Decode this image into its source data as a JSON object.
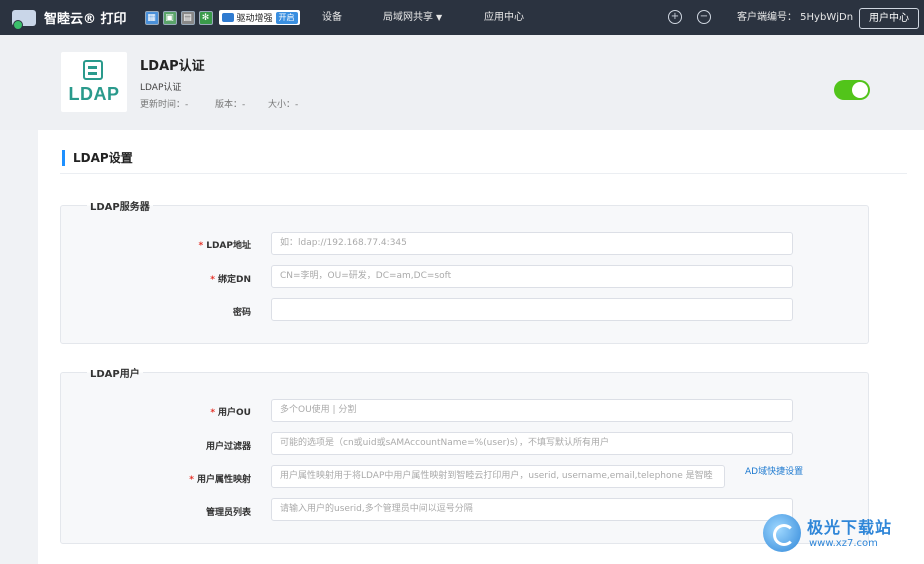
{
  "topbar": {
    "brand": "智睦云® 打印",
    "driver_label": "驱动增强",
    "driver_badge": "开启",
    "nav": [
      "设备",
      "局域网共享",
      "应用中心"
    ],
    "client_id": "客户端编号： 5HybWjDn",
    "user_center": "用户中心"
  },
  "app": {
    "logo_text": "LDAP",
    "title": "LDAP认证",
    "subtitle": "LDAP认证",
    "updated": "更新时间：-",
    "version": "版本：-",
    "size": "大小：-",
    "enabled": true
  },
  "main": {
    "section_title": "LDAP设置",
    "server": {
      "legend": "LDAP服务器",
      "fields": [
        {
          "label": "LDAP地址",
          "required": true,
          "placeholder": "如：ldap://192.168.77.4:345"
        },
        {
          "label": "绑定DN",
          "required": true,
          "placeholder": "CN=李明，OU=研发，DC=am,DC=soft"
        },
        {
          "label": "密码",
          "required": false,
          "placeholder": ""
        }
      ]
    },
    "user": {
      "legend": "LDAP用户",
      "fields": [
        {
          "label": "用户OU",
          "required": true,
          "placeholder": "多个OU使用 | 分割"
        },
        {
          "label": "用户过滤器",
          "required": false,
          "placeholder": "可能的选项是（cn或uid或sAMAccountName=%(user)s），不填写默认所有用户"
        },
        {
          "label": "用户属性映射",
          "required": true,
          "placeholder": "用户属性映射用于将LDAP中用户属性映射到智睦云打印用户，userid, username,email,telephone 是智睦"
        },
        {
          "label": "管理员列表",
          "required": false,
          "placeholder": "请输入用户的userid,多个管理员中间以逗号分隔"
        }
      ],
      "ad_link": "AD域快捷设置"
    }
  },
  "watermark": {
    "name": "极光下载站",
    "url": "www.xz7.com"
  }
}
